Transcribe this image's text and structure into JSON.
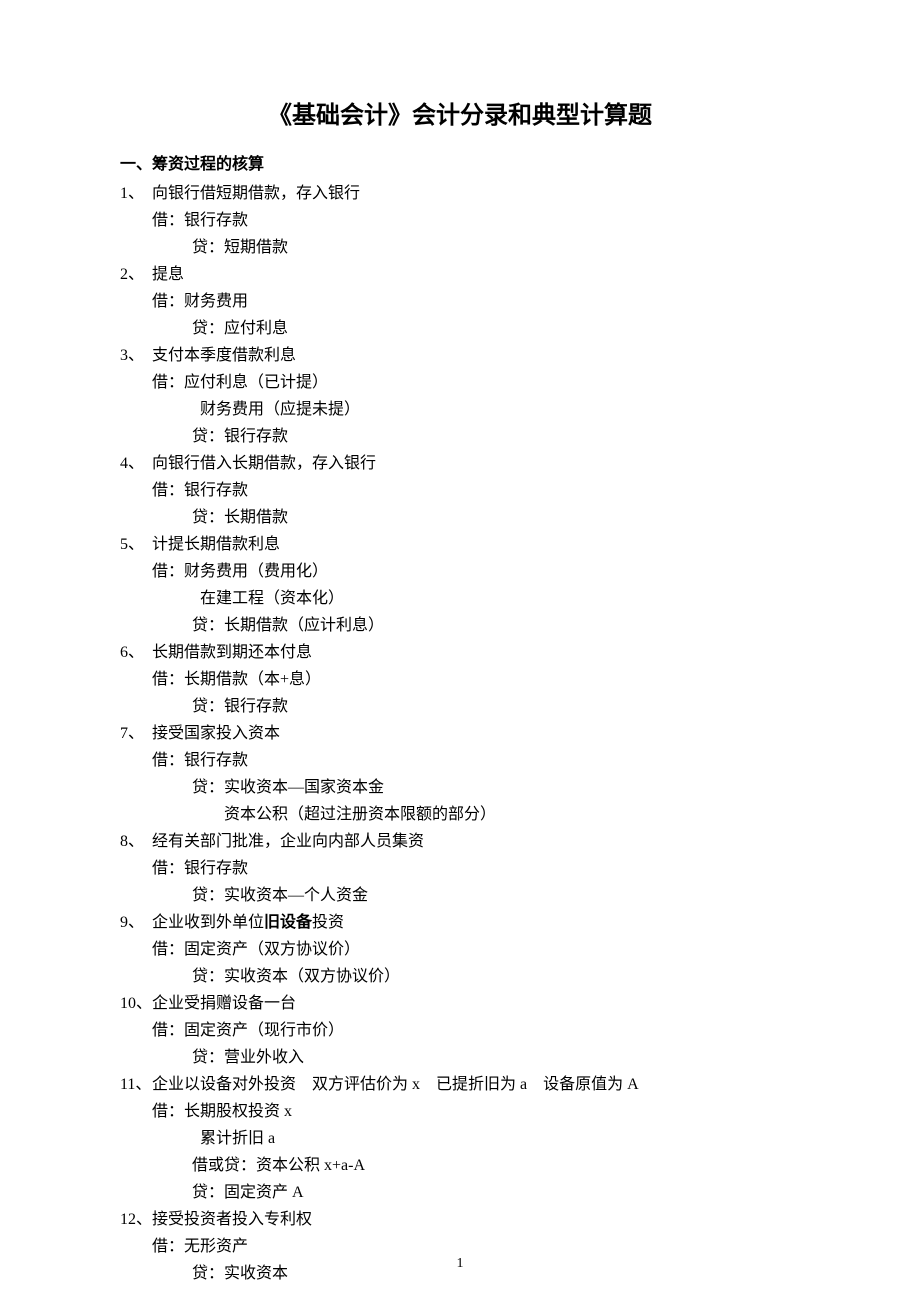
{
  "title": "《基础会计》会计分录和典型计算题",
  "section_heading": "一、筹资过程的核算",
  "items": [
    {
      "num": "1、",
      "head": "向银行借短期借款，存入银行",
      "lines": [
        {
          "cls": "entry",
          "text": "借：银行存款"
        },
        {
          "cls": "entry-credit",
          "text": "贷：短期借款"
        }
      ]
    },
    {
      "num": "2、",
      "head": "提息",
      "lines": [
        {
          "cls": "entry",
          "text": "借：财务费用"
        },
        {
          "cls": "entry-credit",
          "text": "贷：应付利息"
        }
      ]
    },
    {
      "num": "3、",
      "head": "支付本季度借款利息",
      "lines": [
        {
          "cls": "entry",
          "text": "借：应付利息（已计提）"
        },
        {
          "cls": "entry-debit-sub",
          "text": "财务费用（应提未提）"
        },
        {
          "cls": "entry-credit",
          "text": "贷：银行存款"
        }
      ]
    },
    {
      "num": "4、",
      "head": "向银行借入长期借款，存入银行",
      "lines": [
        {
          "cls": "entry",
          "text": "借：银行存款"
        },
        {
          "cls": "entry-credit",
          "text": "贷：长期借款"
        }
      ]
    },
    {
      "num": "5、",
      "head": "计提长期借款利息",
      "lines": [
        {
          "cls": "entry",
          "text": "借：财务费用（费用化）"
        },
        {
          "cls": "entry-debit-sub",
          "text": "在建工程（资本化）"
        },
        {
          "cls": "entry-credit",
          "text": "贷：长期借款（应计利息）"
        }
      ]
    },
    {
      "num": "6、",
      "head": "长期借款到期还本付息",
      "lines": [
        {
          "cls": "entry",
          "text": "借：长期借款（本+息）"
        },
        {
          "cls": "entry-credit",
          "text": "贷：银行存款"
        }
      ]
    },
    {
      "num": "7、",
      "head": "接受国家投入资本",
      "lines": [
        {
          "cls": "entry",
          "text": "借：银行存款"
        },
        {
          "cls": "entry-credit",
          "text": "贷：实收资本—国家资本金"
        },
        {
          "cls": "entry-sub",
          "text": "资本公积（超过注册资本限额的部分）"
        }
      ]
    },
    {
      "num": "8、",
      "head": "经有关部门批准，企业向内部人员集资",
      "lines": [
        {
          "cls": "entry",
          "text": "借：银行存款"
        },
        {
          "cls": "entry-credit",
          "text": "贷：实收资本—个人资金"
        }
      ]
    },
    {
      "num": "9、",
      "head_pre": "企业收到外单位",
      "head_bold": "旧设备",
      "head_post": "投资",
      "lines": [
        {
          "cls": "entry",
          "text": "借：固定资产（双方协议价）"
        },
        {
          "cls": "entry-credit",
          "text": "贷：实收资本（双方协议价）"
        }
      ]
    },
    {
      "num": "10、",
      "head": "企业受捐赠设备一台",
      "lines": [
        {
          "cls": "entry",
          "text": "借：固定资产（现行市价）"
        },
        {
          "cls": "entry-credit",
          "text": "贷：营业外收入"
        }
      ]
    },
    {
      "num": "11、",
      "head": "企业以设备对外投资　双方评估价为 x　已提折旧为 a　设备原值为 A",
      "lines": [
        {
          "cls": "entry",
          "text": "借：长期股权投资 x"
        },
        {
          "cls": "entry-debit-sub",
          "text": "累计折旧 a"
        },
        {
          "cls": "entry-credit",
          "text": "借或贷：资本公积 x+a-A"
        },
        {
          "cls": "entry-credit",
          "text": "贷：固定资产 A"
        }
      ]
    },
    {
      "num": "12、",
      "head": "接受投资者投入专利权",
      "lines": [
        {
          "cls": "entry",
          "text": "借：无形资产"
        },
        {
          "cls": "entry-credit",
          "text": "贷：实收资本"
        }
      ]
    }
  ],
  "page_number": "1"
}
